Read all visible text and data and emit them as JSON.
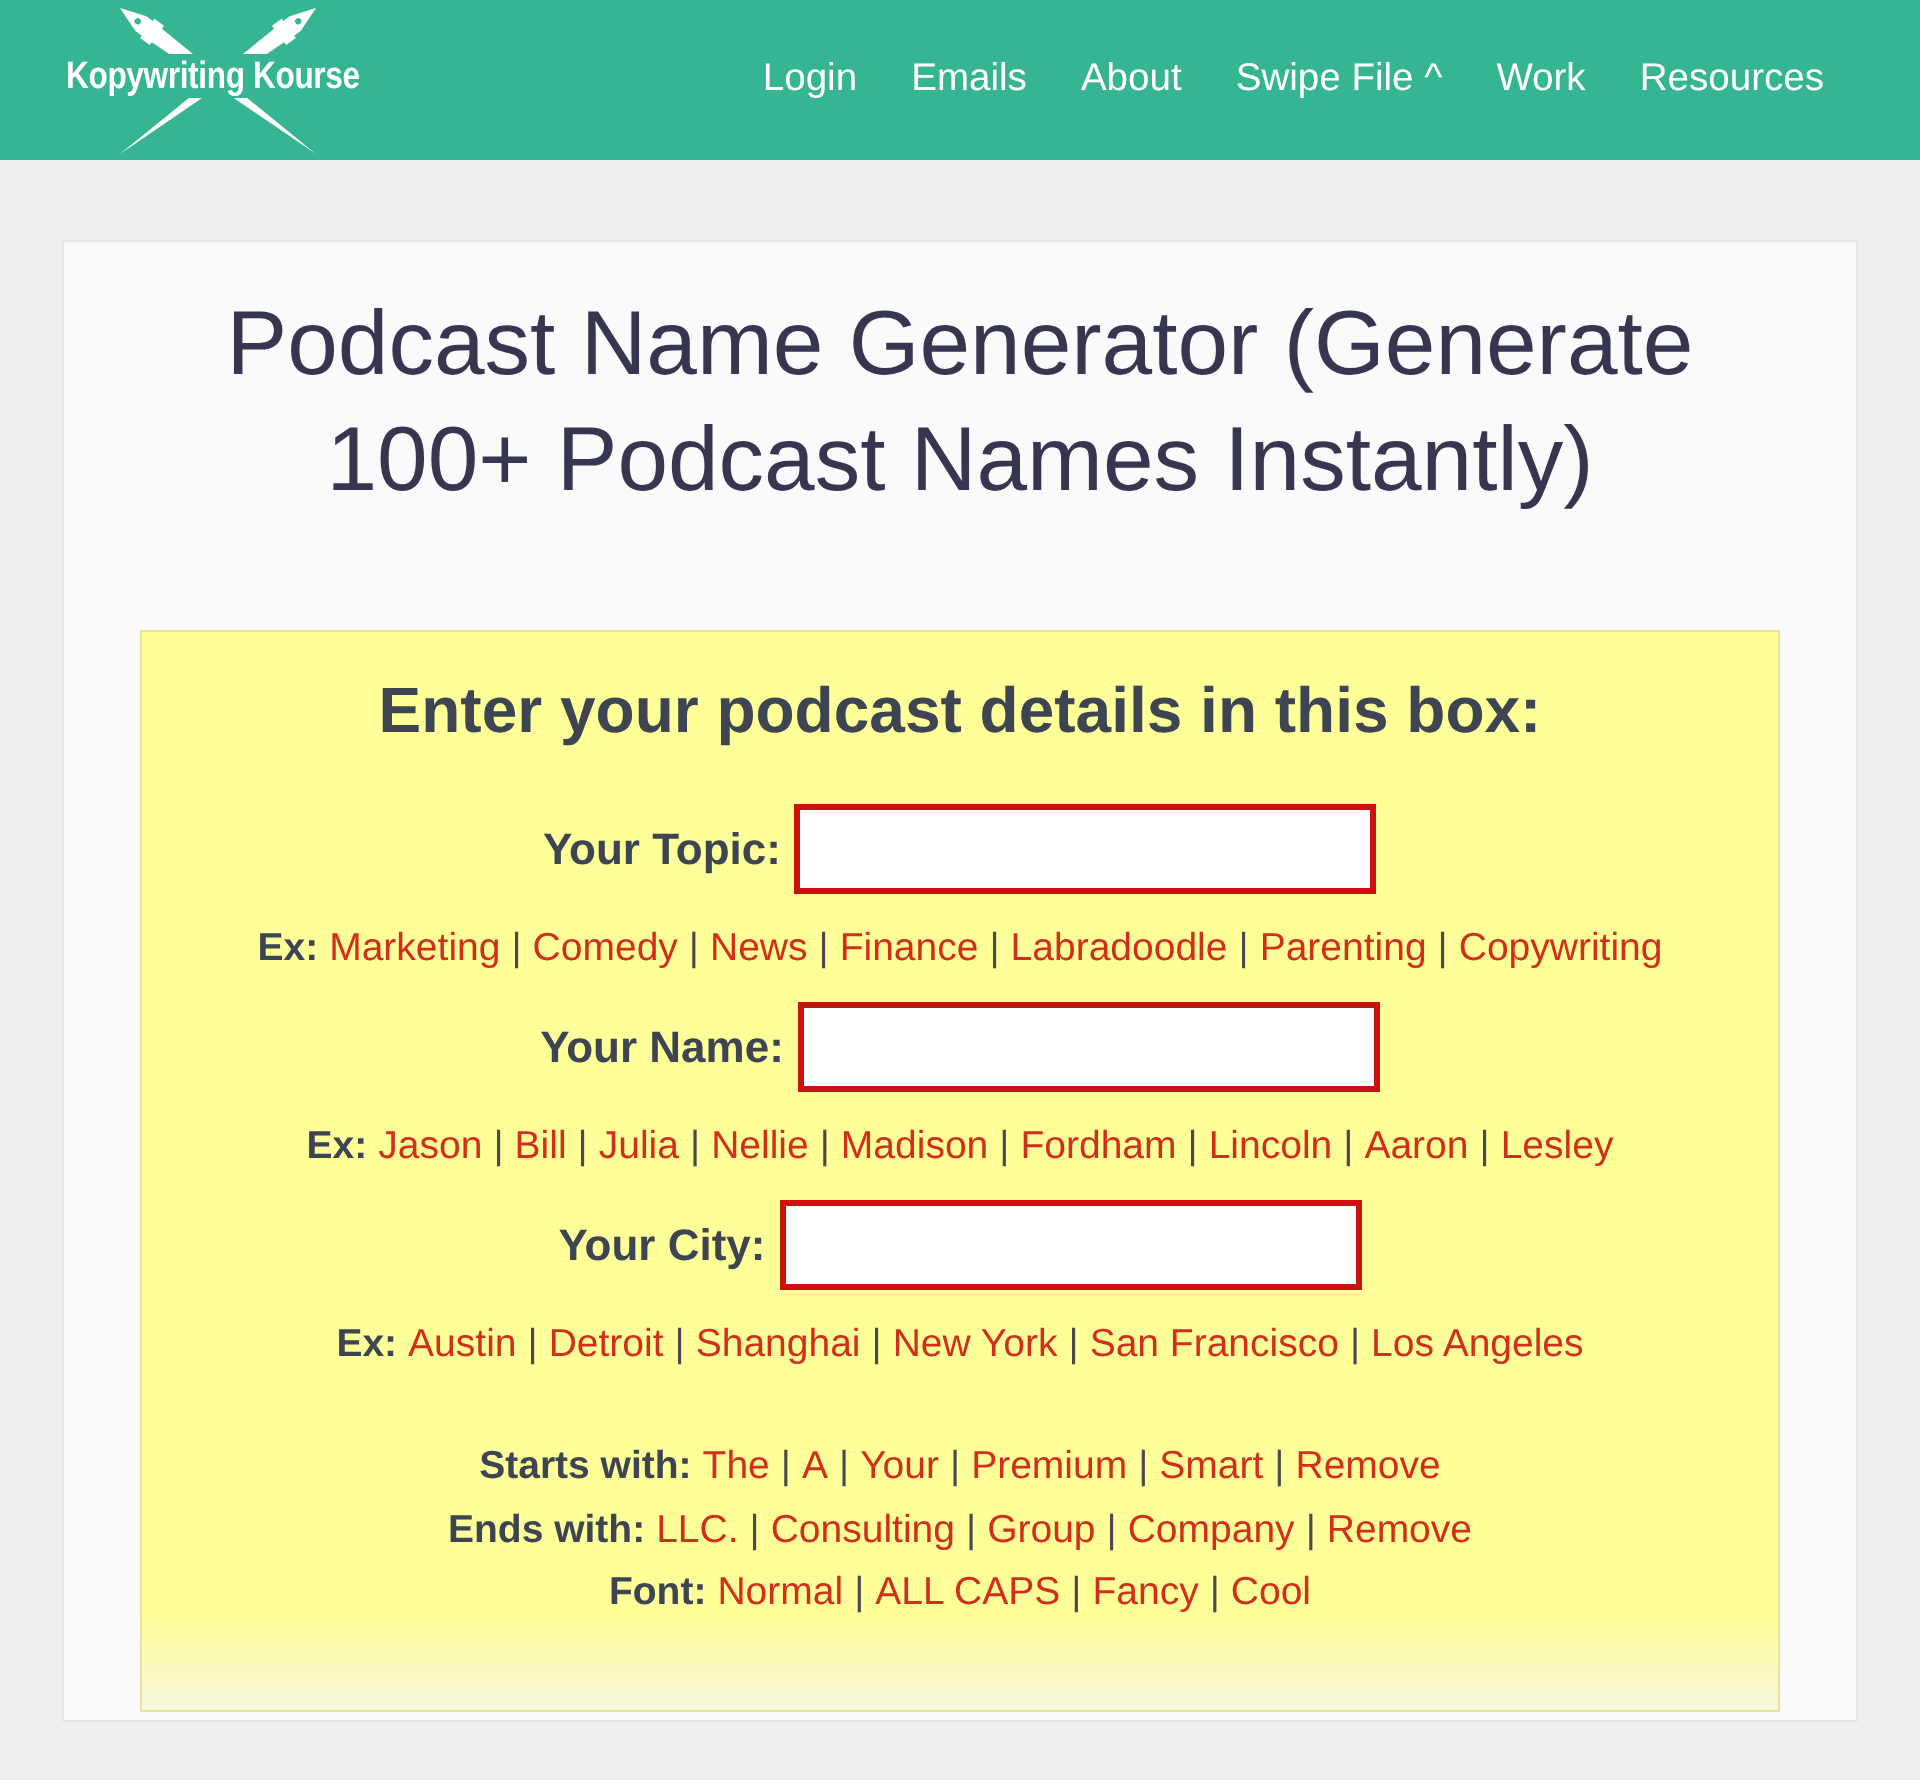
{
  "header": {
    "logo": "Kopywriting Kourse",
    "nav": [
      "Login",
      "Emails",
      "About",
      "Swipe File ^",
      "Work",
      "Resources"
    ]
  },
  "title": "Podcast Name Generator (Generate 100+ Podcast Names Instantly)",
  "box": {
    "heading": "Enter your podcast details in this box:",
    "fields": [
      {
        "label": "Your Topic:",
        "examples_label": "Ex:",
        "examples": [
          {
            "kind": "link",
            "text": "Marketing"
          },
          {
            "kind": "separator",
            "text": "|"
          },
          {
            "kind": "link",
            "text": "Comedy"
          },
          {
            "kind": "separator",
            "text": "|"
          },
          {
            "kind": "link",
            "text": "News"
          },
          {
            "kind": "separator",
            "text": "|"
          },
          {
            "kind": "link",
            "text": "Finance"
          },
          {
            "kind": "separator",
            "text": "|"
          },
          {
            "kind": "link",
            "text": "Labradoodle"
          },
          {
            "kind": "separator",
            "text": "|"
          },
          {
            "kind": "link",
            "text": "Parenting"
          },
          {
            "kind": "separator",
            "text": "|"
          },
          {
            "kind": "link",
            "text": "Copywriting"
          }
        ]
      },
      {
        "label": "Your Name:",
        "examples_label": "Ex:",
        "examples": [
          {
            "kind": "link",
            "text": "Jason"
          },
          {
            "kind": "separator",
            "text": "|"
          },
          {
            "kind": "link",
            "text": "Bill"
          },
          {
            "kind": "separator",
            "text": "|"
          },
          {
            "kind": "link",
            "text": "Julia"
          },
          {
            "kind": "separator",
            "text": "|"
          },
          {
            "kind": "link",
            "text": "Nellie"
          },
          {
            "kind": "separator",
            "text": "|"
          },
          {
            "kind": "link",
            "text": "Madison"
          },
          {
            "kind": "separator",
            "text": "|"
          },
          {
            "kind": "link",
            "text": "Fordham"
          },
          {
            "kind": "separator",
            "text": "|"
          },
          {
            "kind": "link",
            "text": "Lincoln"
          },
          {
            "kind": "separator",
            "text": "|"
          },
          {
            "kind": "link",
            "text": "Aaron"
          },
          {
            "kind": "separator",
            "text": "|"
          },
          {
            "kind": "link",
            "text": "Lesley"
          }
        ]
      },
      {
        "label": "Your City:",
        "examples_label": "Ex:",
        "examples": [
          {
            "kind": "link",
            "text": "Austin"
          },
          {
            "kind": "separator",
            "text": "|"
          },
          {
            "kind": "link",
            "text": "Detroit"
          },
          {
            "kind": "separator",
            "text": "|"
          },
          {
            "kind": "link",
            "text": "Shanghai"
          },
          {
            "kind": "separator",
            "text": "|"
          },
          {
            "kind": "link",
            "text": "New York"
          },
          {
            "kind": "separator",
            "text": "|"
          },
          {
            "kind": "link",
            "text": "San Francisco"
          },
          {
            "kind": "separator",
            "text": "|"
          },
          {
            "kind": "link",
            "text": "Los Angeles"
          }
        ]
      }
    ],
    "options": [
      {
        "label": "Starts with:",
        "choices": [
          {
            "kind": "link",
            "text": "The"
          },
          {
            "kind": "separator",
            "text": "|"
          },
          {
            "kind": "link",
            "text": "A"
          },
          {
            "kind": "separator",
            "text": "|"
          },
          {
            "kind": "link",
            "text": "Your"
          },
          {
            "kind": "separator",
            "text": "|"
          },
          {
            "kind": "link",
            "text": "Premium"
          },
          {
            "kind": "separator",
            "text": "|"
          },
          {
            "kind": "link",
            "text": "Smart"
          },
          {
            "kind": "separator",
            "text": "|"
          },
          {
            "kind": "link",
            "text": "Remove"
          }
        ]
      },
      {
        "label": "Ends with:",
        "choices": [
          {
            "kind": "link",
            "text": "LLC."
          },
          {
            "kind": "separator",
            "text": "|"
          },
          {
            "kind": "link",
            "text": "Consulting"
          },
          {
            "kind": "separator",
            "text": "|"
          },
          {
            "kind": "link",
            "text": "Group"
          },
          {
            "kind": "separator",
            "text": "|"
          },
          {
            "kind": "link",
            "text": "Company"
          },
          {
            "kind": "separator",
            "text": "|"
          },
          {
            "kind": "link",
            "text": "Remove"
          }
        ]
      },
      {
        "label": "Font:",
        "choices": [
          {
            "kind": "link",
            "text": "Normal"
          },
          {
            "kind": "separator",
            "text": "|"
          },
          {
            "kind": "link",
            "text": "ALL CAPS"
          },
          {
            "kind": "separator",
            "text": "|"
          },
          {
            "kind": "link",
            "text": "Fancy"
          },
          {
            "kind": "separator",
            "text": "|"
          },
          {
            "kind": "link",
            "text": "Cool"
          }
        ]
      }
    ]
  }
}
